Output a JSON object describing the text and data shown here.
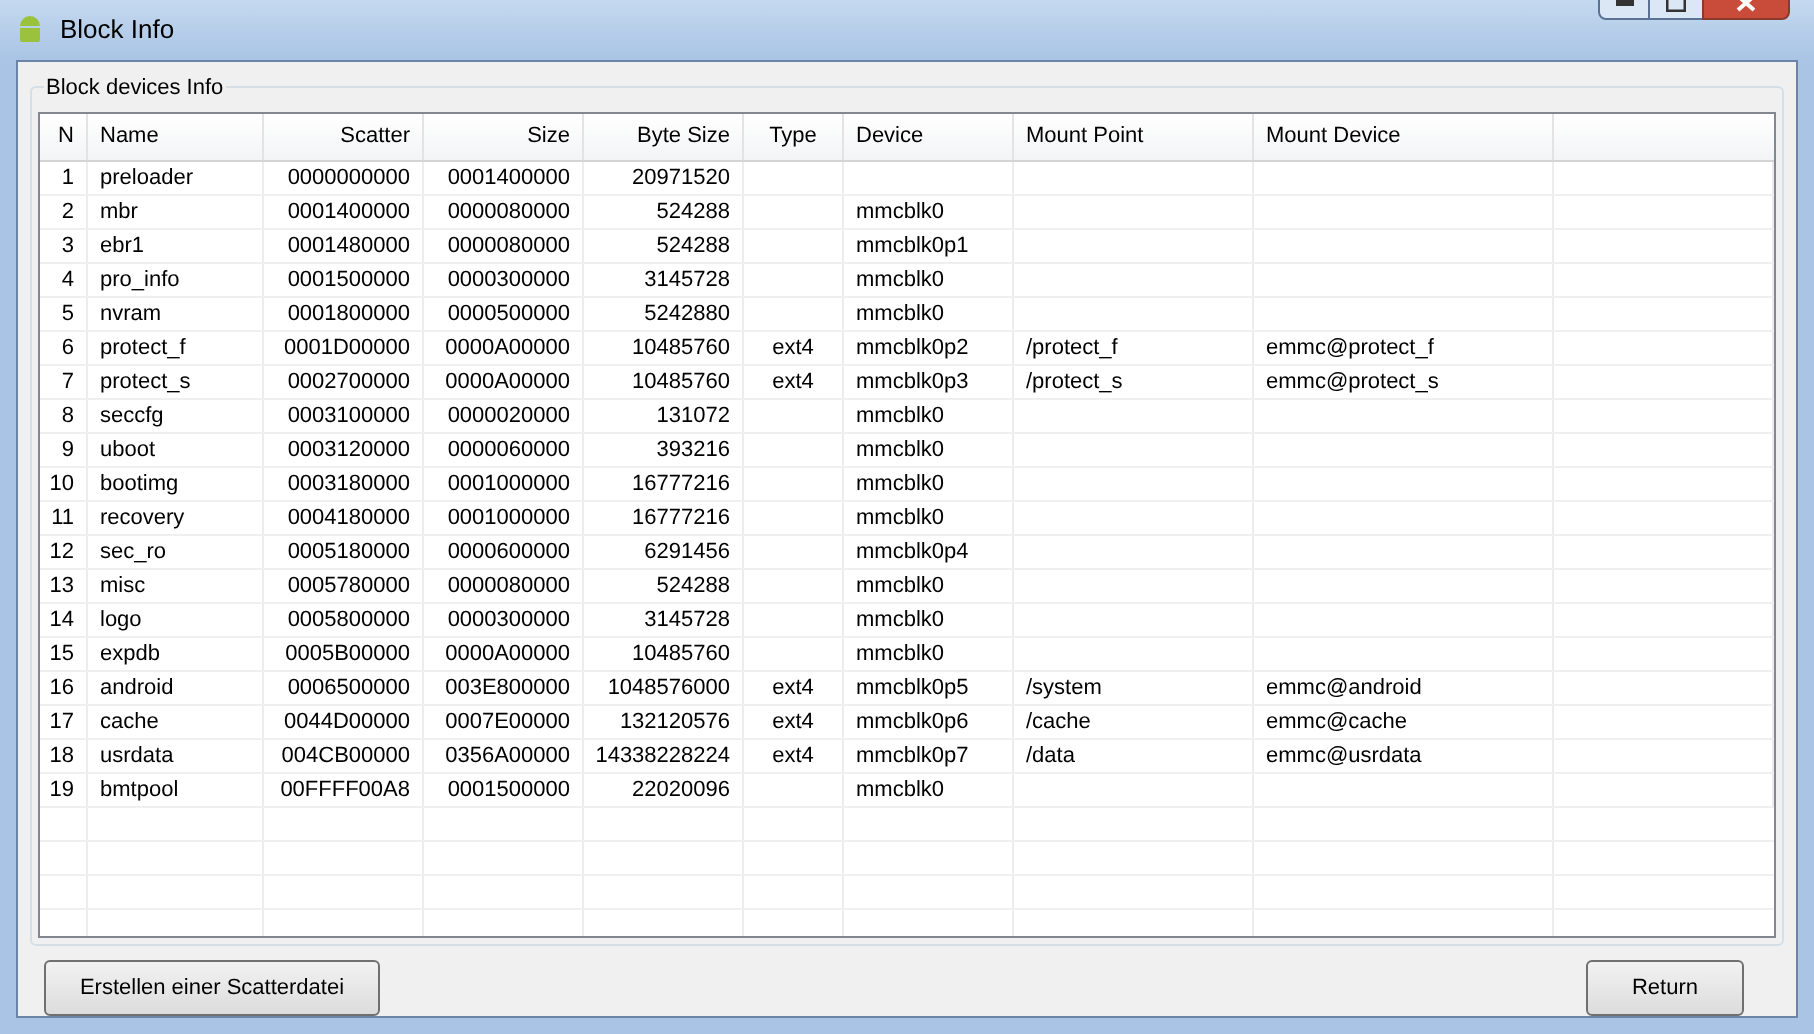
{
  "window": {
    "title": "Block Info"
  },
  "group": {
    "title": "Block devices Info"
  },
  "table": {
    "columns": [
      "N",
      "Name",
      "Scatter",
      "Size",
      "Byte Size",
      "Type",
      "Device",
      "Mount Point",
      "Mount Device"
    ],
    "rows": [
      [
        "1",
        "preloader",
        "0000000000",
        "0001400000",
        "20971520",
        "",
        "",
        "",
        ""
      ],
      [
        "2",
        "mbr",
        "0001400000",
        "0000080000",
        "524288",
        "",
        "mmcblk0",
        "",
        ""
      ],
      [
        "3",
        "ebr1",
        "0001480000",
        "0000080000",
        "524288",
        "",
        "mmcblk0p1",
        "",
        ""
      ],
      [
        "4",
        "pro_info",
        "0001500000",
        "0000300000",
        "3145728",
        "",
        "mmcblk0",
        "",
        ""
      ],
      [
        "5",
        "nvram",
        "0001800000",
        "0000500000",
        "5242880",
        "",
        "mmcblk0",
        "",
        ""
      ],
      [
        "6",
        "protect_f",
        "0001D00000",
        "0000A00000",
        "10485760",
        "ext4",
        "mmcblk0p2",
        "/protect_f",
        "emmc@protect_f"
      ],
      [
        "7",
        "protect_s",
        "0002700000",
        "0000A00000",
        "10485760",
        "ext4",
        "mmcblk0p3",
        "/protect_s",
        "emmc@protect_s"
      ],
      [
        "8",
        "seccfg",
        "0003100000",
        "0000020000",
        "131072",
        "",
        "mmcblk0",
        "",
        ""
      ],
      [
        "9",
        "uboot",
        "0003120000",
        "0000060000",
        "393216",
        "",
        "mmcblk0",
        "",
        ""
      ],
      [
        "10",
        "bootimg",
        "0003180000",
        "0001000000",
        "16777216",
        "",
        "mmcblk0",
        "",
        ""
      ],
      [
        "11",
        "recovery",
        "0004180000",
        "0001000000",
        "16777216",
        "",
        "mmcblk0",
        "",
        ""
      ],
      [
        "12",
        "sec_ro",
        "0005180000",
        "0000600000",
        "6291456",
        "",
        "mmcblk0p4",
        "",
        ""
      ],
      [
        "13",
        "misc",
        "0005780000",
        "0000080000",
        "524288",
        "",
        "mmcblk0",
        "",
        ""
      ],
      [
        "14",
        "logo",
        "0005800000",
        "0000300000",
        "3145728",
        "",
        "mmcblk0",
        "",
        ""
      ],
      [
        "15",
        "expdb",
        "0005B00000",
        "0000A00000",
        "10485760",
        "",
        "mmcblk0",
        "",
        ""
      ],
      [
        "16",
        "android",
        "0006500000",
        "003E800000",
        "1048576000",
        "ext4",
        "mmcblk0p5",
        "/system",
        "emmc@android"
      ],
      [
        "17",
        "cache",
        "0044D00000",
        "0007E00000",
        "132120576",
        "ext4",
        "mmcblk0p6",
        "/cache",
        "emmc@cache"
      ],
      [
        "18",
        "usrdata",
        "004CB00000",
        "0356A00000",
        "14338228224",
        "ext4",
        "mmcblk0p7",
        "/data",
        "emmc@usrdata"
      ],
      [
        "19",
        "bmtpool",
        "00FFFF00A8",
        "0001500000",
        "22020096",
        "",
        "mmcblk0",
        "",
        ""
      ]
    ]
  },
  "buttons": [
    "Erstellen einer Scatterdatei",
    "Return"
  ]
}
